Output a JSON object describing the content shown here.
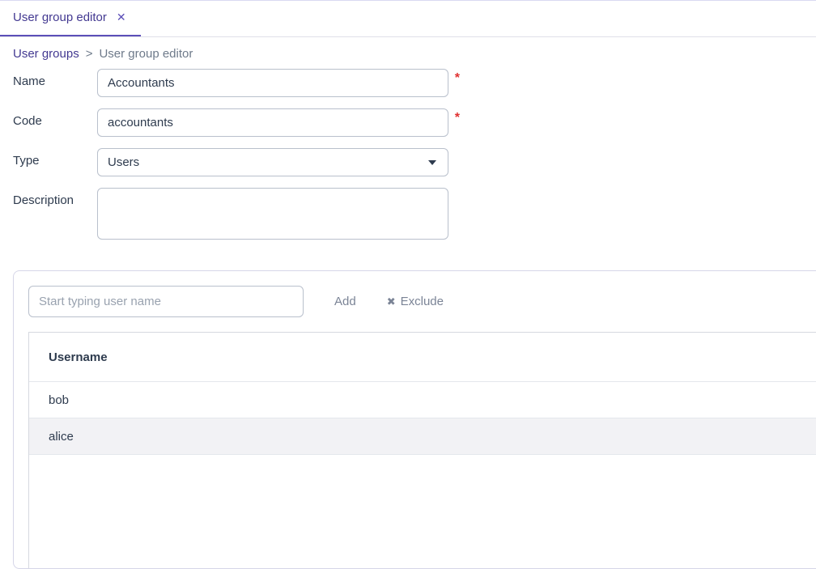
{
  "tab": {
    "title": "User group editor"
  },
  "breadcrumb": {
    "root": "User groups",
    "sep": ">",
    "current": "User group editor"
  },
  "form": {
    "labels": {
      "name": "Name",
      "code": "Code",
      "type": "Type",
      "description": "Description"
    },
    "values": {
      "name": "Accountants",
      "code": "accountants",
      "type": "Users",
      "description": ""
    },
    "required_mark": "*"
  },
  "members": {
    "search_placeholder": "Start typing user name",
    "add_label": "Add",
    "exclude_label": "Exclude",
    "column_header": "Username",
    "rows": [
      "bob",
      "alice"
    ]
  }
}
